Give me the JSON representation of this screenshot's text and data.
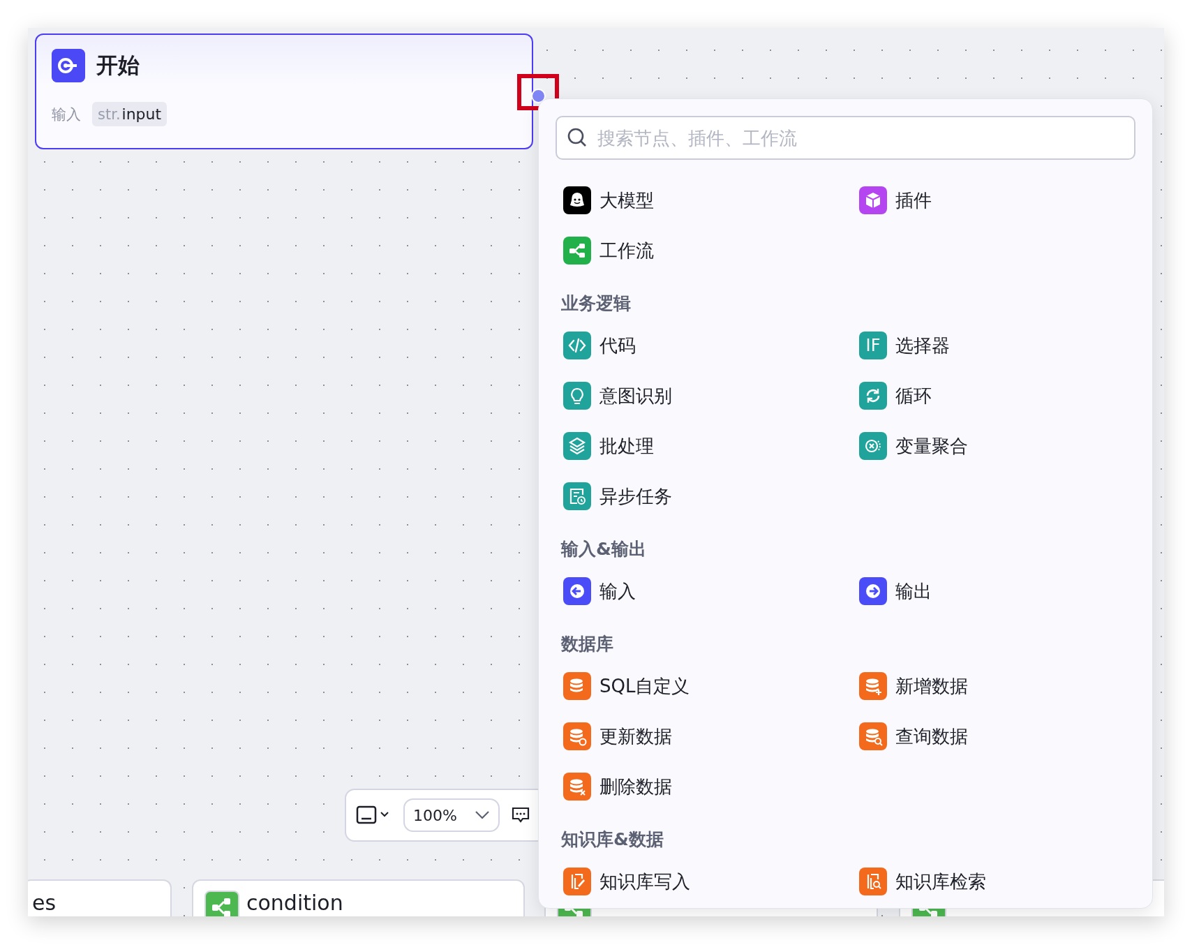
{
  "start_node": {
    "title": "开始",
    "input_label": "输入",
    "param": {
      "type": "str.",
      "name": "input"
    }
  },
  "node_picker": {
    "search": {
      "placeholder": "搜索节点、插件、工作流"
    },
    "sections": [
      {
        "items": [
          {
            "label": "大模型",
            "kind": "llm"
          },
          {
            "label": "插件",
            "kind": "plugin"
          },
          {
            "label": "工作流",
            "kind": "workflow"
          }
        ]
      },
      {
        "title": "业务逻辑",
        "items": [
          {
            "label": "代码",
            "kind": "code"
          },
          {
            "label": "选择器",
            "kind": "if",
            "icon_text": "IF"
          },
          {
            "label": "意图识别",
            "kind": "intent"
          },
          {
            "label": "循环",
            "kind": "loop"
          },
          {
            "label": "批处理",
            "kind": "batch"
          },
          {
            "label": "变量聚合",
            "kind": "aggregate"
          },
          {
            "label": "异步任务",
            "kind": "async"
          }
        ]
      },
      {
        "title": "输入&输出",
        "items": [
          {
            "label": "输入",
            "kind": "input"
          },
          {
            "label": "输出",
            "kind": "output"
          }
        ]
      },
      {
        "title": "数据库",
        "items": [
          {
            "label": "SQL自定义",
            "kind": "db"
          },
          {
            "label": "新增数据",
            "kind": "db-add"
          },
          {
            "label": "更新数据",
            "kind": "db-update"
          },
          {
            "label": "查询数据",
            "kind": "db-query"
          },
          {
            "label": "删除数据",
            "kind": "db-delete"
          }
        ]
      },
      {
        "title": "知识库&数据",
        "items": [
          {
            "label": "知识库写入",
            "kind": "kb-write"
          },
          {
            "label": "知识库检索",
            "kind": "kb-search"
          }
        ]
      }
    ]
  },
  "toolbar": {
    "zoom": "100%"
  },
  "bottom_nodes": [
    {
      "title": "es"
    },
    {
      "title": "condition"
    }
  ]
}
